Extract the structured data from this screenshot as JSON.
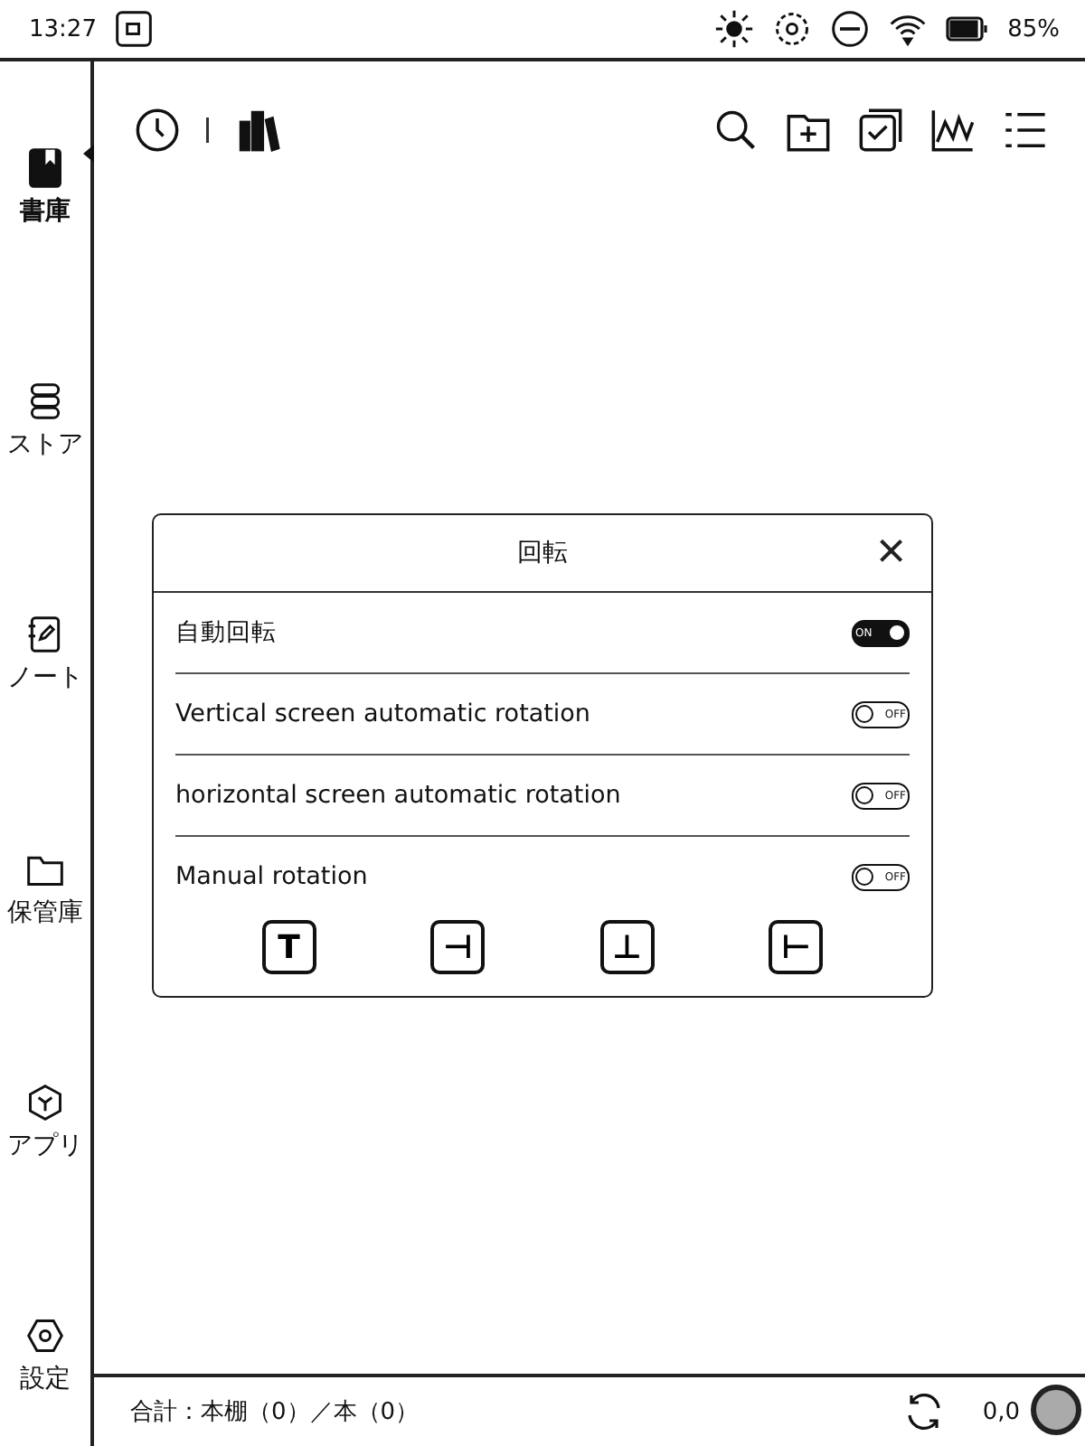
{
  "status_bar": {
    "time": "13:27",
    "battery": "85%"
  },
  "sidebar": {
    "items": [
      {
        "label": "書庫",
        "selected": true
      },
      {
        "label": "ストア",
        "selected": false
      },
      {
        "label": "ノート",
        "selected": false
      },
      {
        "label": "保管庫",
        "selected": false
      },
      {
        "label": "アプリ",
        "selected": false
      },
      {
        "label": "設定",
        "selected": false
      }
    ]
  },
  "dialog": {
    "title": "回転",
    "close": "×",
    "rows": [
      {
        "label": "自動回転",
        "on": true,
        "switch_text": "ON"
      },
      {
        "label": "Vertical screen automatic rotation",
        "on": false,
        "switch_text": "OFF"
      },
      {
        "label": "horizontal screen automatic rotation",
        "on": false,
        "switch_text": "OFF"
      },
      {
        "label": "Manual rotation",
        "on": false,
        "switch_text": "OFF"
      }
    ],
    "orientations": [
      {
        "glyph": "T"
      },
      {
        "glyph": "⊣"
      },
      {
        "glyph": "⊥"
      },
      {
        "glyph": "⊢"
      }
    ]
  },
  "footer": {
    "summary": "合計：本棚（0）／本（0）",
    "page": "0,0"
  }
}
